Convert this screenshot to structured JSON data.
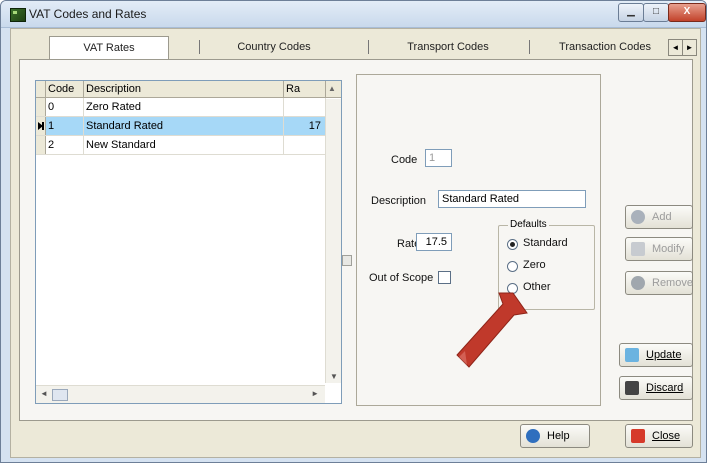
{
  "window": {
    "title": "VAT Codes and Rates",
    "minimize": "▁",
    "maximize": "□",
    "close": "X"
  },
  "tabs": [
    {
      "label": "VAT Rates",
      "active": true
    },
    {
      "label": "Country Codes",
      "active": false
    },
    {
      "label": "Transport Codes",
      "active": false
    },
    {
      "label": "Transaction Codes",
      "active": false
    }
  ],
  "tab_scroll": {
    "left": "◄",
    "right": "►"
  },
  "grid": {
    "columns": [
      "Code",
      "Description",
      "Ra"
    ],
    "header_arrow": "▲",
    "rows": [
      {
        "code": "0",
        "description": "Zero Rated",
        "rate": ""
      },
      {
        "code": "1",
        "description": "Standard Rated",
        "rate": "17"
      },
      {
        "code": "2",
        "description": "New Standard",
        "rate": ""
      }
    ],
    "selected_row": 1,
    "scroll": {
      "up": "▲",
      "down": "▼",
      "left": "◄",
      "right": "►"
    }
  },
  "form": {
    "code_label": "Code",
    "code_value": "1",
    "description_label": "Description",
    "description_value": "Standard Rated",
    "rate_label": "Rate",
    "rate_value": "17.5",
    "out_of_scope_label": "Out of Scope",
    "out_of_scope_checked": false,
    "defaults_title": "Defaults",
    "defaults_options": [
      "Standard",
      "Zero",
      "Other"
    ],
    "defaults_selected": "Standard"
  },
  "buttons": {
    "add": "Add",
    "modify": "Modify",
    "remove": "Remove",
    "update": "Update",
    "discard": "Discard",
    "help": "Help",
    "close": "Close"
  },
  "colors": {
    "selection": "#a6d8f7",
    "annotation_arrow": "#c0392b",
    "titlebar": "#c9d9ec"
  }
}
